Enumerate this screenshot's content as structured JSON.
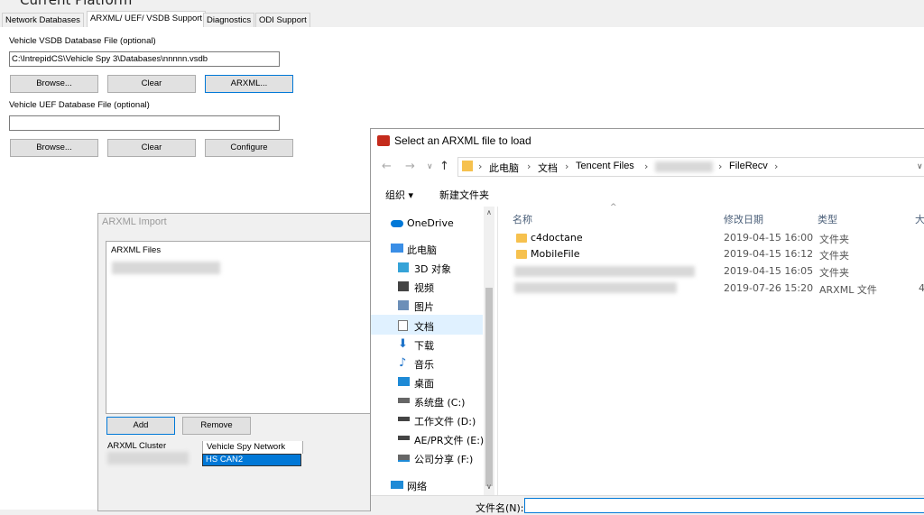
{
  "page_title": "Current Platform",
  "tabs": [
    {
      "label": "Network Databases"
    },
    {
      "label": "ARXML/ UEF/ VSDB Support"
    },
    {
      "label": "Diagnostics"
    },
    {
      "label": "ODI Support"
    }
  ],
  "vsdb": {
    "label": "Vehicle VSDB Database File (optional)",
    "value": "C:\\IntrepidCS\\Vehicle Spy 3\\Databases\\nnnnn.vsdb",
    "browse": "Browse...",
    "clear": "Clear",
    "arxml": "ARXML..."
  },
  "uef": {
    "label": "Vehicle UEF Database File (optional)",
    "value": "",
    "browse": "Browse...",
    "clear": "Clear",
    "configure": "Configure"
  },
  "arxml_import": {
    "title": "ARXML Import",
    "files_header": "ARXML Files",
    "add": "Add",
    "remove": "Remove",
    "col_cluster": "ARXML Cluster",
    "col_network": "Vehicle Spy Network",
    "network_value": "HS CAN2"
  },
  "file_dialog": {
    "title": "Select an ARXML file to load",
    "breadcrumbs": [
      "此电脑",
      "文档",
      "Tencent Files",
      "FileRecv"
    ],
    "organize": "组织 ▾",
    "new_folder": "新建文件夹",
    "nav": [
      {
        "label": "OneDrive",
        "icon": "cloud-icon"
      },
      {
        "label": "此电脑",
        "icon": "computer-icon"
      },
      {
        "label": "3D 对象",
        "icon": "cube-icon"
      },
      {
        "label": "视频",
        "icon": "video-icon"
      },
      {
        "label": "图片",
        "icon": "picture-icon"
      },
      {
        "label": "文档",
        "icon": "document-icon"
      },
      {
        "label": "下载",
        "icon": "download-icon"
      },
      {
        "label": "音乐",
        "icon": "music-icon"
      },
      {
        "label": "桌面",
        "icon": "desktop-icon"
      },
      {
        "label": "系统盘 (C:)",
        "icon": "drive-icon"
      },
      {
        "label": "工作文件 (D:)",
        "icon": "drive-icon"
      },
      {
        "label": "AE/PR文件 (E:)",
        "icon": "drive-icon"
      },
      {
        "label": "公司分享 (F:)",
        "icon": "network-drive-icon"
      },
      {
        "label": "网络",
        "icon": "network-icon"
      }
    ],
    "columns": {
      "name": "名称",
      "date": "修改日期",
      "type": "类型",
      "size": "大"
    },
    "files": [
      {
        "name": "c4doctane",
        "date": "2019-04-15 16:00",
        "type": "文件夹"
      },
      {
        "name": "MobileFile",
        "date": "2019-04-15 16:12",
        "type": "文件夹"
      },
      {
        "name": "",
        "date": "2019-04-15 16:05",
        "type": "文件夹"
      },
      {
        "name": "",
        "date": "2019-07-26 15:20",
        "type": "ARXML 文件",
        "size": "4"
      }
    ],
    "filename_label": "文件名(N):"
  }
}
